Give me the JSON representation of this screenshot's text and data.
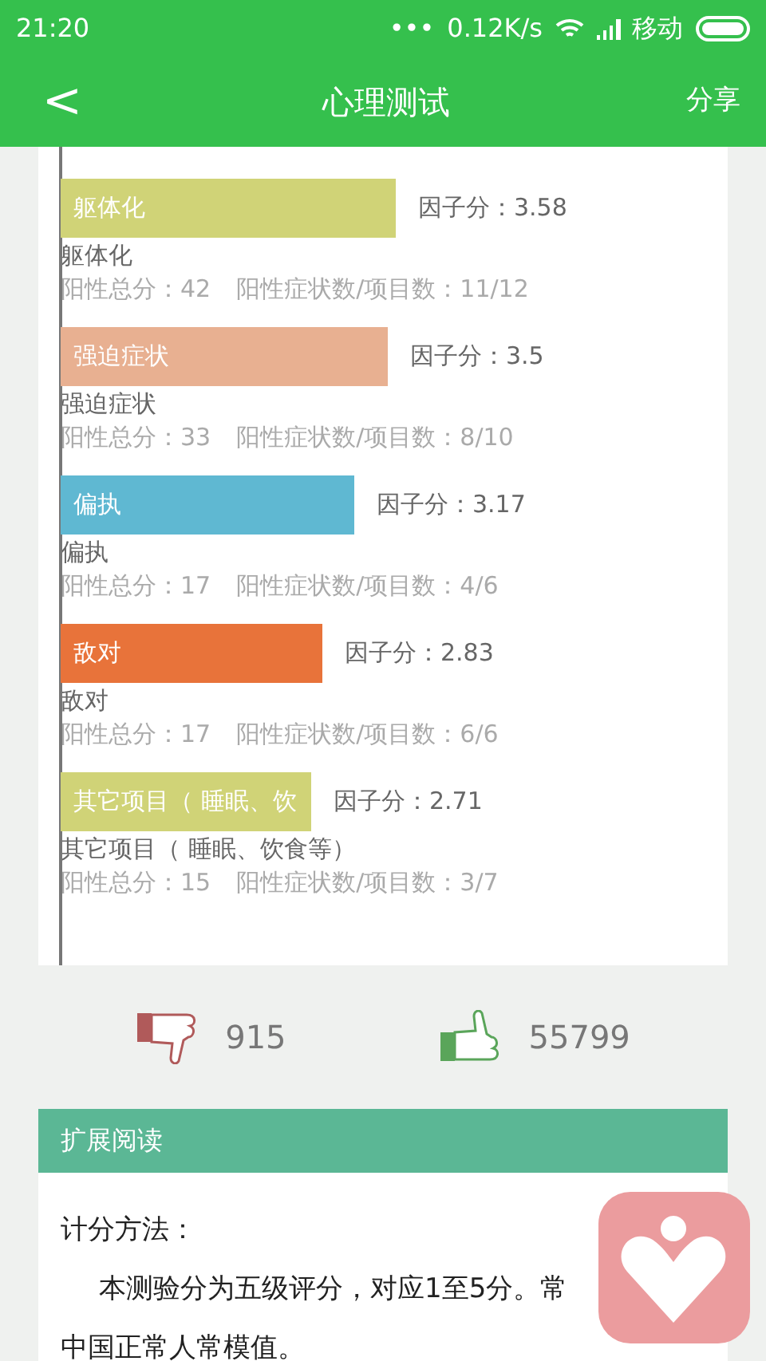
{
  "status_bar": {
    "time": "21:20",
    "dots": "•••",
    "speed": "0.12K/s",
    "carrier": "移动"
  },
  "app_bar": {
    "back": "<",
    "title": "心理测试",
    "share": "分享"
  },
  "factors": [
    {
      "bar_label": "躯体化",
      "color": "#d0d377",
      "score": "因子分：3.58",
      "name": "躯体化",
      "total": "阳性总分：42",
      "ratio": "阳性症状数/项目数：11/12"
    },
    {
      "bar_label": "强迫症状",
      "color": "#e8b091",
      "score": "因子分：3.5",
      "name": "强迫症状",
      "total": "阳性总分：33",
      "ratio": "阳性症状数/项目数：8/10"
    },
    {
      "bar_label": "偏执",
      "color": "#5fb8d2",
      "score": "因子分：3.17",
      "name": "偏执",
      "total": "阳性总分：17",
      "ratio": "阳性症状数/项目数：4/6"
    },
    {
      "bar_label": "敌对",
      "color": "#e8733a",
      "score": "因子分：2.83",
      "name": "敌对",
      "total": "阳性总分：17",
      "ratio": "阳性症状数/项目数：6/6"
    },
    {
      "bar_label": "其它项目（ 睡眠、饮",
      "color": "#d0d377",
      "score": "因子分：2.71",
      "name": "其它项目（ 睡眠、饮食等）",
      "total": "阳性总分：15",
      "ratio": "阳性症状数/项目数：3/7"
    }
  ],
  "votes": {
    "down": "915",
    "up": "55799"
  },
  "reading": {
    "header": "扩展阅读",
    "heading": "计分方法：",
    "line_1": "本测验分为五级评分，对应1至5分。常",
    "line_2": "中国正常人常模值。"
  }
}
